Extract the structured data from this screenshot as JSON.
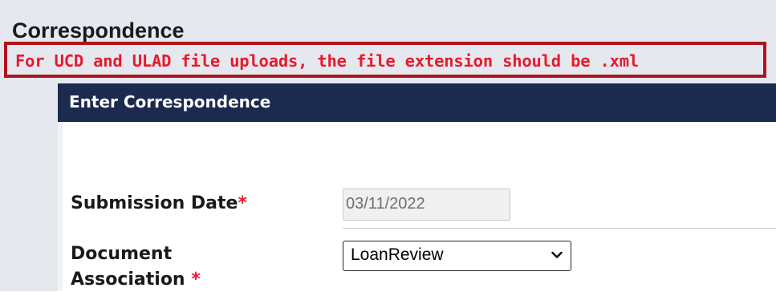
{
  "page": {
    "title": "Correspondence",
    "notice": "For UCD and ULAD file uploads, the file extension should be .xml"
  },
  "panel": {
    "header_title": "Enter Correspondence"
  },
  "form": {
    "submission_date": {
      "label": "Submission Date",
      "required_mark": "*",
      "value": "03/11/2022"
    },
    "document_association": {
      "label_line1": "Document",
      "label_line2": "Association",
      "required_mark": "*",
      "selected": "LoanReview"
    }
  },
  "colors": {
    "header_bg": "#1b2a4e",
    "notice_text": "#e8192c",
    "notice_border": "#b0141b",
    "required": "#e8192c"
  },
  "icons": {
    "select_chevron": "chevron-down-icon"
  }
}
